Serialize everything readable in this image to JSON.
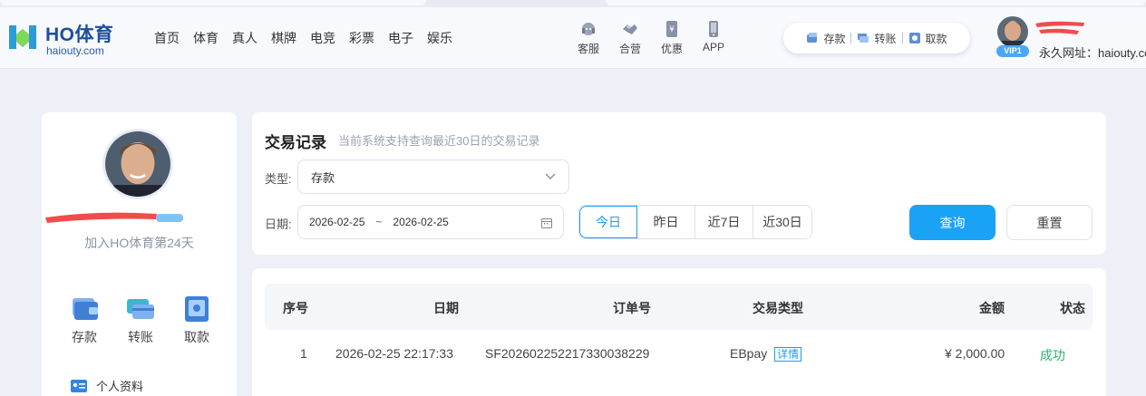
{
  "brand": {
    "name": "HO体育",
    "url": "haiouty.com",
    "colors": {
      "primary": "#1aa3f4",
      "brand_blue": "#1e4e9c",
      "success": "#2bb46a",
      "page_bg": "#eef0f8"
    }
  },
  "nav": {
    "items": [
      "首页",
      "体育",
      "真人",
      "棋牌",
      "电竞",
      "彩票",
      "电子",
      "娱乐"
    ]
  },
  "quick_links": [
    {
      "label": "客服",
      "icon": "headset-icon"
    },
    {
      "label": "合营",
      "icon": "handshake-icon"
    },
    {
      "label": "优惠",
      "icon": "coupon-icon"
    },
    {
      "label": "APP",
      "icon": "phone-icon"
    }
  ],
  "wallet_pill": {
    "deposit": "存款",
    "transfer": "转账",
    "withdraw": "取款"
  },
  "user": {
    "vip": "VIP1",
    "permanent_url": "永久网址：haiouty.com",
    "join_days": "加入HO体育第24天"
  },
  "sidebar": {
    "wallet": [
      {
        "label": "存款",
        "icon": "deposit-wallet-icon"
      },
      {
        "label": "转账",
        "icon": "transfer-cards-icon"
      },
      {
        "label": "取款",
        "icon": "withdraw-safe-icon"
      }
    ],
    "profile": "个人资料"
  },
  "filter": {
    "title": "交易记录",
    "subtitle": "当前系统支持查询最近30日的交易记录",
    "type_label": "类型:",
    "type_value": "存款",
    "date_label": "日期:",
    "date_start": "2026-02-25",
    "date_sep": "~",
    "date_end": "2026-02-25",
    "ranges": [
      "今日",
      "昨日",
      "近7日",
      "近30日"
    ],
    "active_range": "今日",
    "query": "查询",
    "reset": "重置"
  },
  "table": {
    "headers": [
      "序号",
      "日期",
      "订单号",
      "交易类型",
      "金额",
      "状态"
    ],
    "rows": [
      {
        "index": "1",
        "date": "2026-02-25 22:17:33",
        "order": "SF202602252217330038229",
        "type": "EBpay",
        "detail": "详情",
        "amount": "¥ 2,000.00",
        "status": "成功"
      }
    ]
  }
}
